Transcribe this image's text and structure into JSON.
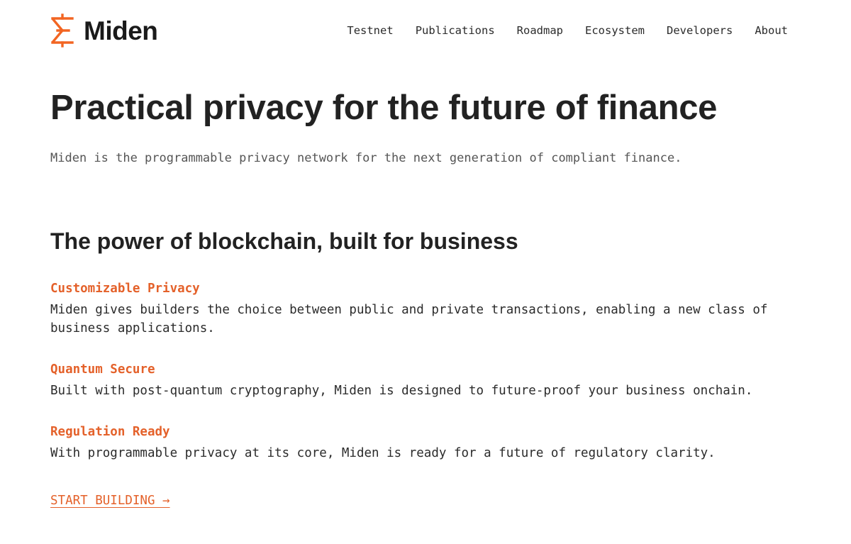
{
  "brand": {
    "name": "Miden",
    "logo_icon": "miden-sigma-logo",
    "accent_color": "#e4612a"
  },
  "nav": {
    "items": [
      {
        "label": "Testnet"
      },
      {
        "label": "Publications"
      },
      {
        "label": "Roadmap"
      },
      {
        "label": "Ecosystem"
      },
      {
        "label": "Developers"
      },
      {
        "label": "About"
      }
    ]
  },
  "hero": {
    "title": "Practical privacy for the future of finance",
    "subtitle": "Miden is the programmable privacy network for the next generation of compliant finance."
  },
  "section": {
    "title": "The power of blockchain, built for business",
    "features": [
      {
        "title": "Customizable Privacy",
        "description": "Miden gives builders the choice between public and private transactions, enabling a new class of business applications."
      },
      {
        "title": "Quantum Secure",
        "description": "Built with post-quantum cryptography, Miden is designed to future-proof your business onchain."
      },
      {
        "title": "Regulation Ready",
        "description": "With programmable privacy at its core, Miden is ready for a future of regulatory clarity."
      }
    ]
  },
  "cta": {
    "label": "START BUILDING →"
  }
}
